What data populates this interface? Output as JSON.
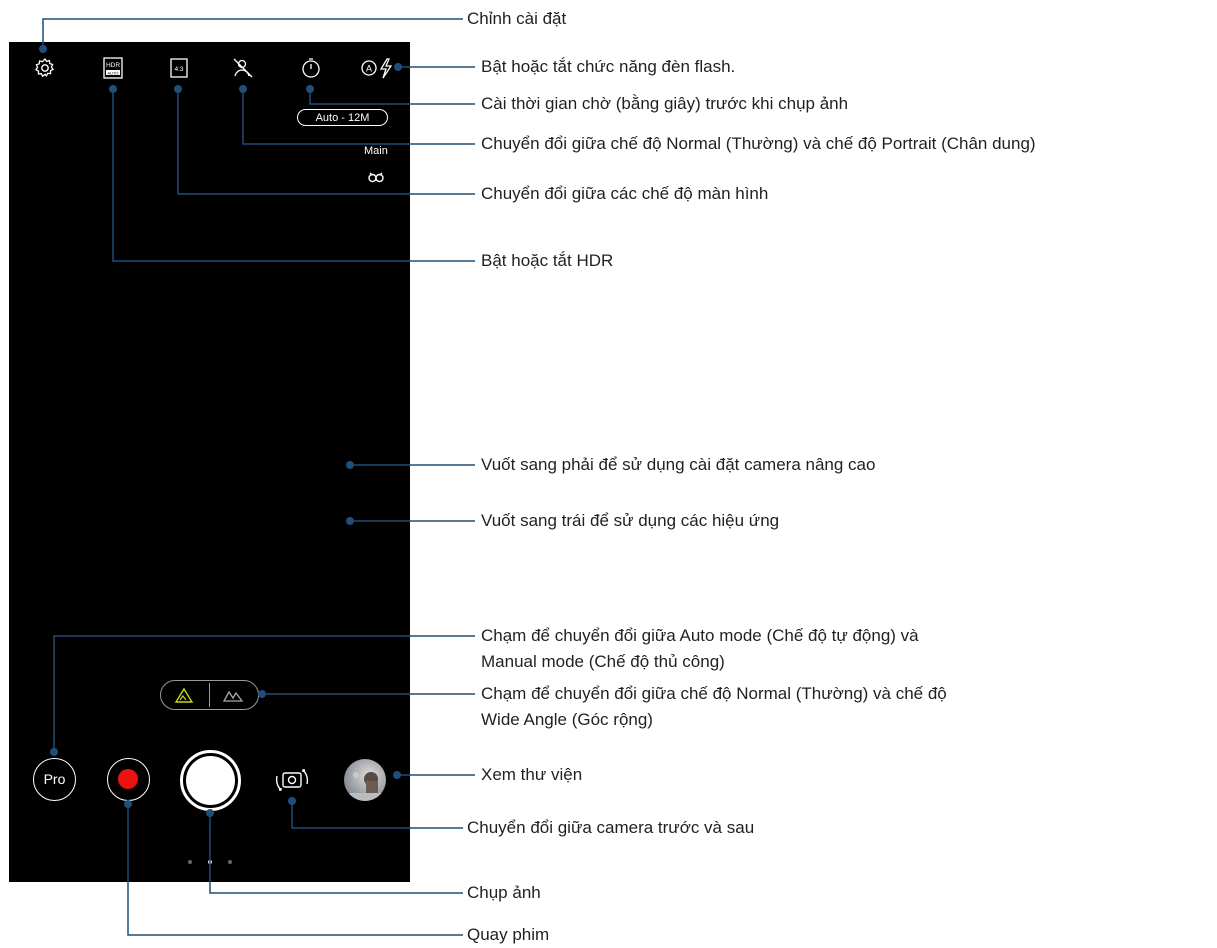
{
  "camera": {
    "resolution_label": "Auto - 12M",
    "lens_label": "Main",
    "pro_label": "Pro",
    "icons": [
      "settings-gear-icon",
      "hdr-auto-icon",
      "aspect-ratio-icon",
      "portrait-mode-icon",
      "timer-icon",
      "flash-auto-icon"
    ],
    "accent_color": "#c8d41e",
    "record_color": "#e11111"
  },
  "callouts": {
    "settings": "Chỉnh cài đặt",
    "flash": "Bật hoặc tắt chức năng đèn flash.",
    "timer": "Cài thời gian chờ (bằng giây) trước khi chụp ảnh",
    "portrait": "Chuyển đổi giữa chế độ Normal (Thường) và chế độ Portrait (Chân dung)",
    "screen_mode": "Chuyển đổi giữa các chế độ màn hình",
    "hdr": "Bật hoặc tắt HDR",
    "swipe_right": "Vuốt sang phải để sử dụng cài đặt camera nâng cao",
    "swipe_left": "Vuốt sang trái để sử dụng các hiệu ứng",
    "auto_manual_line1": "Chạm để chuyển đổi giữa Auto mode (Chế độ tự động) và",
    "auto_manual_line2": "Manual mode (Chế độ thủ công)",
    "wide_angle_line1": "Chạm để chuyển đổi giữa chế độ Normal (Thường) và chế độ",
    "wide_angle_line2": "Wide Angle (Góc rộng)",
    "gallery": "Xem thư viện",
    "switch_camera": "Chuyển đổi giữa camera trước và sau",
    "take_photo": "Chụp ảnh",
    "record_video": "Quay phim"
  }
}
